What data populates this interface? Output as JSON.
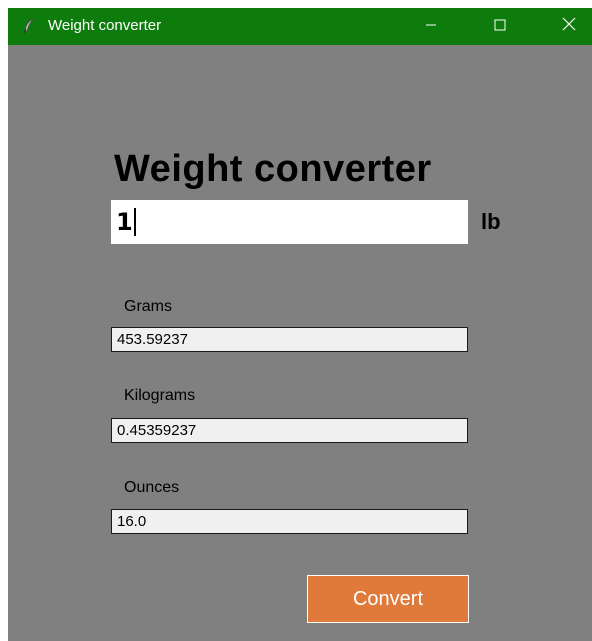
{
  "window": {
    "title": "Weight converter"
  },
  "main": {
    "heading": "Weight converter",
    "input_value": "1",
    "unit": "lb",
    "fields": [
      {
        "label": "Grams",
        "value": "453.59237"
      },
      {
        "label": "Kilograms",
        "value": "0.45359237"
      },
      {
        "label": "Ounces",
        "value": "16.0"
      }
    ],
    "convert_label": "Convert"
  },
  "colors": {
    "titlebar": "#0d7c0d",
    "background": "#808080",
    "button": "#e07a3a"
  },
  "icons": {
    "app": "feather-icon",
    "minimize": "minimize-icon",
    "maximize": "maximize-icon",
    "close": "close-icon"
  }
}
